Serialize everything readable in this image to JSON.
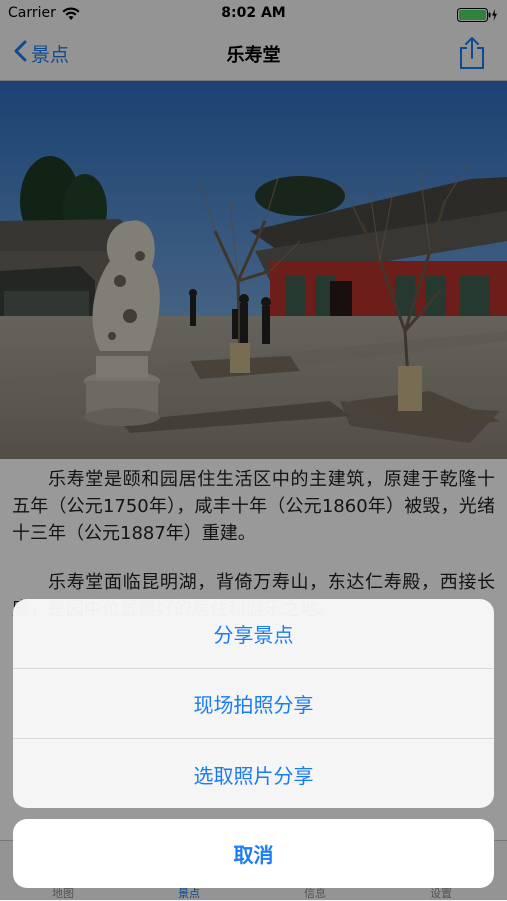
{
  "status_bar": {
    "carrier": "Carrier",
    "time": "8:02 AM"
  },
  "nav": {
    "back_label": "景点",
    "title": "乐寿堂"
  },
  "article": {
    "paragraphs": [
      "乐寿堂是颐和园居住生活区中的主建筑，原建于乾隆十五年（公元1750年），咸丰十年（公元1860年）被毁，光绪十三年（公元1887年）重建。",
      "乐寿堂面临昆明湖，背倚万寿山，东达仁寿殿，西接长廊，是园中位置最好的居住和游乐之地。"
    ]
  },
  "tabs": [
    {
      "label": "地图",
      "icon": "map-icon"
    },
    {
      "label": "景点",
      "icon": "scenic-icon"
    },
    {
      "label": "信息",
      "icon": "info-icon"
    },
    {
      "label": "设置",
      "icon": "settings-icon"
    }
  ],
  "action_sheet": {
    "options": [
      "分享景点",
      "现场拍照分享",
      "选取照片分享"
    ],
    "cancel": "取消"
  },
  "colors": {
    "accent": "#1a7cf2",
    "sky": "#3a78c4",
    "wall_red": "#b8332c"
  }
}
